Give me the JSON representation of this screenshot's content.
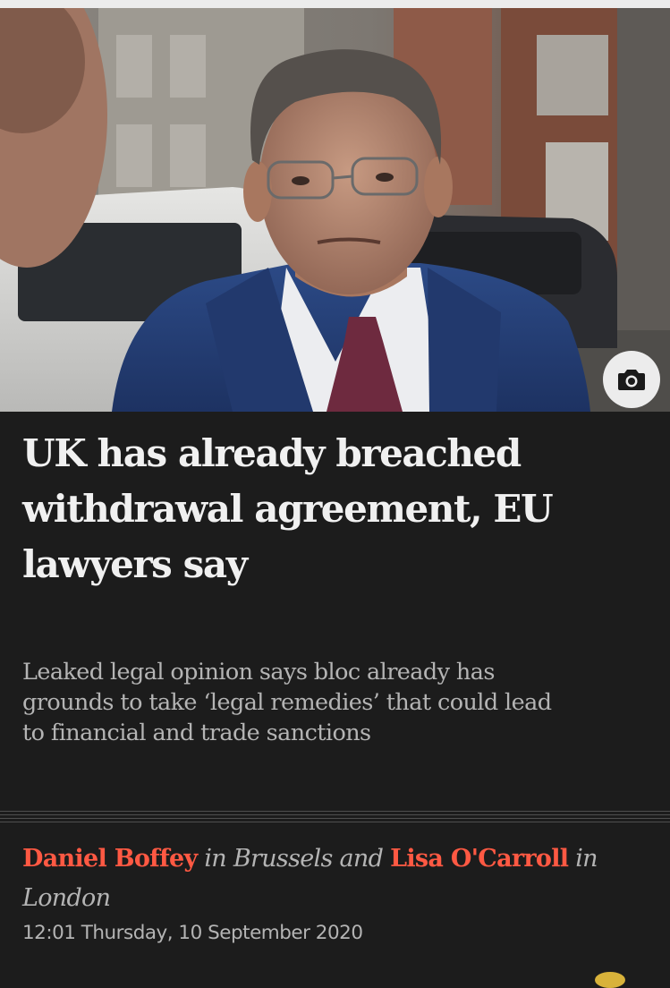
{
  "colors": {
    "background": "#1c1c1c",
    "headline": "#f0f0f0",
    "secondary_text": "#b4b4b4",
    "author_link": "#ff5943",
    "divider": "#4e4e4e"
  },
  "hero": {
    "camera_icon": "camera-icon"
  },
  "article": {
    "headline": "UK has already breached withdrawal agreement, EU lawyers say",
    "standfirst": "Leaked legal opinion says bloc already has grounds to take ‘legal remedies’ that could lead to financial and trade sanctions",
    "byline": {
      "author1": "Daniel Boffey",
      "in1": "in",
      "location1": "Brussels",
      "and": "and",
      "author2": "Lisa O'Carroll",
      "in2": "in",
      "location2": "London"
    },
    "timestamp": "12:01 Thursday, 10 September 2020"
  }
}
